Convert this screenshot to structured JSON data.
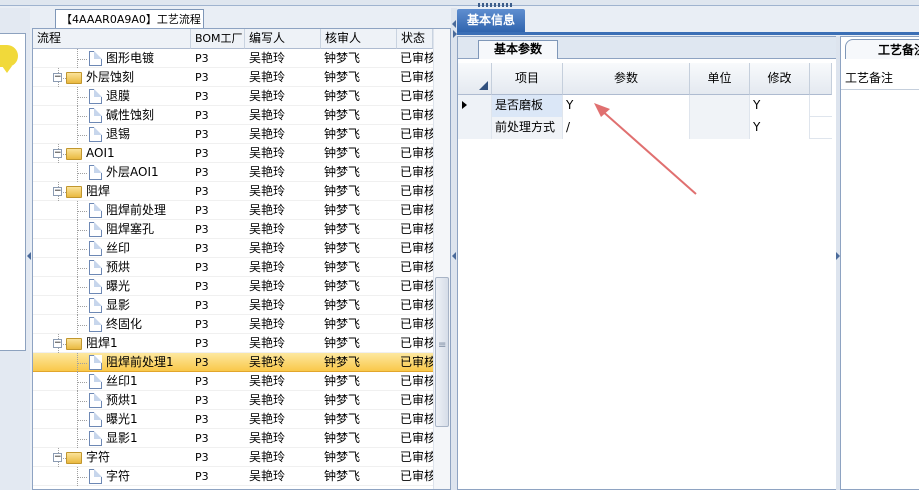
{
  "tree_panel": {
    "tab_title": "【4AAAR0A9A0】工艺流程",
    "columns": [
      "流程",
      "BOM工厂",
      "编写人",
      "核审人",
      "状态"
    ],
    "rows": [
      {
        "label": "图形电镀",
        "type": "doc",
        "level": 2,
        "bom": "P3",
        "writer": "吴艳玲",
        "reviewer": "钟梦飞",
        "status": "已审核",
        "selected": false
      },
      {
        "label": "外层蚀刻",
        "type": "folder",
        "level": 1,
        "bom": "P3",
        "writer": "吴艳玲",
        "reviewer": "钟梦飞",
        "status": "已审核",
        "selected": false
      },
      {
        "label": "退膜",
        "type": "doc",
        "level": 2,
        "bom": "P3",
        "writer": "吴艳玲",
        "reviewer": "钟梦飞",
        "status": "已审核",
        "selected": false
      },
      {
        "label": "碱性蚀刻",
        "type": "doc",
        "level": 2,
        "bom": "P3",
        "writer": "吴艳玲",
        "reviewer": "钟梦飞",
        "status": "已审核",
        "selected": false
      },
      {
        "label": "退锡",
        "type": "doc",
        "level": 2,
        "bom": "P3",
        "writer": "吴艳玲",
        "reviewer": "钟梦飞",
        "status": "已审核",
        "selected": false
      },
      {
        "label": "AOI1",
        "type": "folder",
        "level": 1,
        "bom": "P3",
        "writer": "吴艳玲",
        "reviewer": "钟梦飞",
        "status": "已审核",
        "selected": false
      },
      {
        "label": "外层AOI1",
        "type": "doc",
        "level": 2,
        "bom": "P3",
        "writer": "吴艳玲",
        "reviewer": "钟梦飞",
        "status": "已审核",
        "selected": false
      },
      {
        "label": "阻焊",
        "type": "folder",
        "level": 1,
        "bom": "P3",
        "writer": "吴艳玲",
        "reviewer": "钟梦飞",
        "status": "已审核",
        "selected": false
      },
      {
        "label": "阻焊前处理",
        "type": "doc",
        "level": 2,
        "bom": "P3",
        "writer": "吴艳玲",
        "reviewer": "钟梦飞",
        "status": "已审核",
        "selected": false
      },
      {
        "label": "阻焊塞孔",
        "type": "doc",
        "level": 2,
        "bom": "P3",
        "writer": "吴艳玲",
        "reviewer": "钟梦飞",
        "status": "已审核",
        "selected": false
      },
      {
        "label": "丝印",
        "type": "doc",
        "level": 2,
        "bom": "P3",
        "writer": "吴艳玲",
        "reviewer": "钟梦飞",
        "status": "已审核",
        "selected": false
      },
      {
        "label": "预烘",
        "type": "doc",
        "level": 2,
        "bom": "P3",
        "writer": "吴艳玲",
        "reviewer": "钟梦飞",
        "status": "已审核",
        "selected": false
      },
      {
        "label": "曝光",
        "type": "doc",
        "level": 2,
        "bom": "P3",
        "writer": "吴艳玲",
        "reviewer": "钟梦飞",
        "status": "已审核",
        "selected": false
      },
      {
        "label": "显影",
        "type": "doc",
        "level": 2,
        "bom": "P3",
        "writer": "吴艳玲",
        "reviewer": "钟梦飞",
        "status": "已审核",
        "selected": false
      },
      {
        "label": "终固化",
        "type": "doc",
        "level": 2,
        "bom": "P3",
        "writer": "吴艳玲",
        "reviewer": "钟梦飞",
        "status": "已审核",
        "selected": false
      },
      {
        "label": "阻焊1",
        "type": "folder",
        "level": 1,
        "bom": "P3",
        "writer": "吴艳玲",
        "reviewer": "钟梦飞",
        "status": "已审核",
        "selected": false
      },
      {
        "label": "阻焊前处理1",
        "type": "doc",
        "level": 2,
        "bom": "P3",
        "writer": "吴艳玲",
        "reviewer": "钟梦飞",
        "status": "已审核",
        "selected": true
      },
      {
        "label": "丝印1",
        "type": "doc",
        "level": 2,
        "bom": "P3",
        "writer": "吴艳玲",
        "reviewer": "钟梦飞",
        "status": "已审核",
        "selected": false
      },
      {
        "label": "预烘1",
        "type": "doc",
        "level": 2,
        "bom": "P3",
        "writer": "吴艳玲",
        "reviewer": "钟梦飞",
        "status": "已审核",
        "selected": false
      },
      {
        "label": "曝光1",
        "type": "doc",
        "level": 2,
        "bom": "P3",
        "writer": "吴艳玲",
        "reviewer": "钟梦飞",
        "status": "已审核",
        "selected": false
      },
      {
        "label": "显影1",
        "type": "doc",
        "level": 2,
        "bom": "P3",
        "writer": "吴艳玲",
        "reviewer": "钟梦飞",
        "status": "已审核",
        "selected": false
      },
      {
        "label": "字符",
        "type": "folder",
        "level": 1,
        "bom": "P3",
        "writer": "吴艳玲",
        "reviewer": "钟梦飞",
        "status": "已审核",
        "selected": false
      },
      {
        "label": "字符",
        "type": "doc",
        "level": 2,
        "bom": "P3",
        "writer": "吴艳玲",
        "reviewer": "钟梦飞",
        "status": "已审核",
        "selected": false
      }
    ]
  },
  "info_panel": {
    "title": "基本信息",
    "subtab": "基本参数",
    "columns": [
      "项目",
      "参数",
      "单位",
      "修改"
    ],
    "rows": [
      {
        "item": "是否磨板",
        "param": "Y",
        "unit": "",
        "modify": "Y",
        "current": true
      },
      {
        "item": "前处理方式",
        "param": "/",
        "unit": "",
        "modify": "Y",
        "current": false
      }
    ]
  },
  "remark_panel": {
    "tab": "工艺备注",
    "label": "工艺备注"
  },
  "colors": {
    "selected_row": "#f9c84a",
    "title_tab": "#2e63ad",
    "annotation_arrow": "#e07070",
    "bubble": "#f1d93a"
  }
}
